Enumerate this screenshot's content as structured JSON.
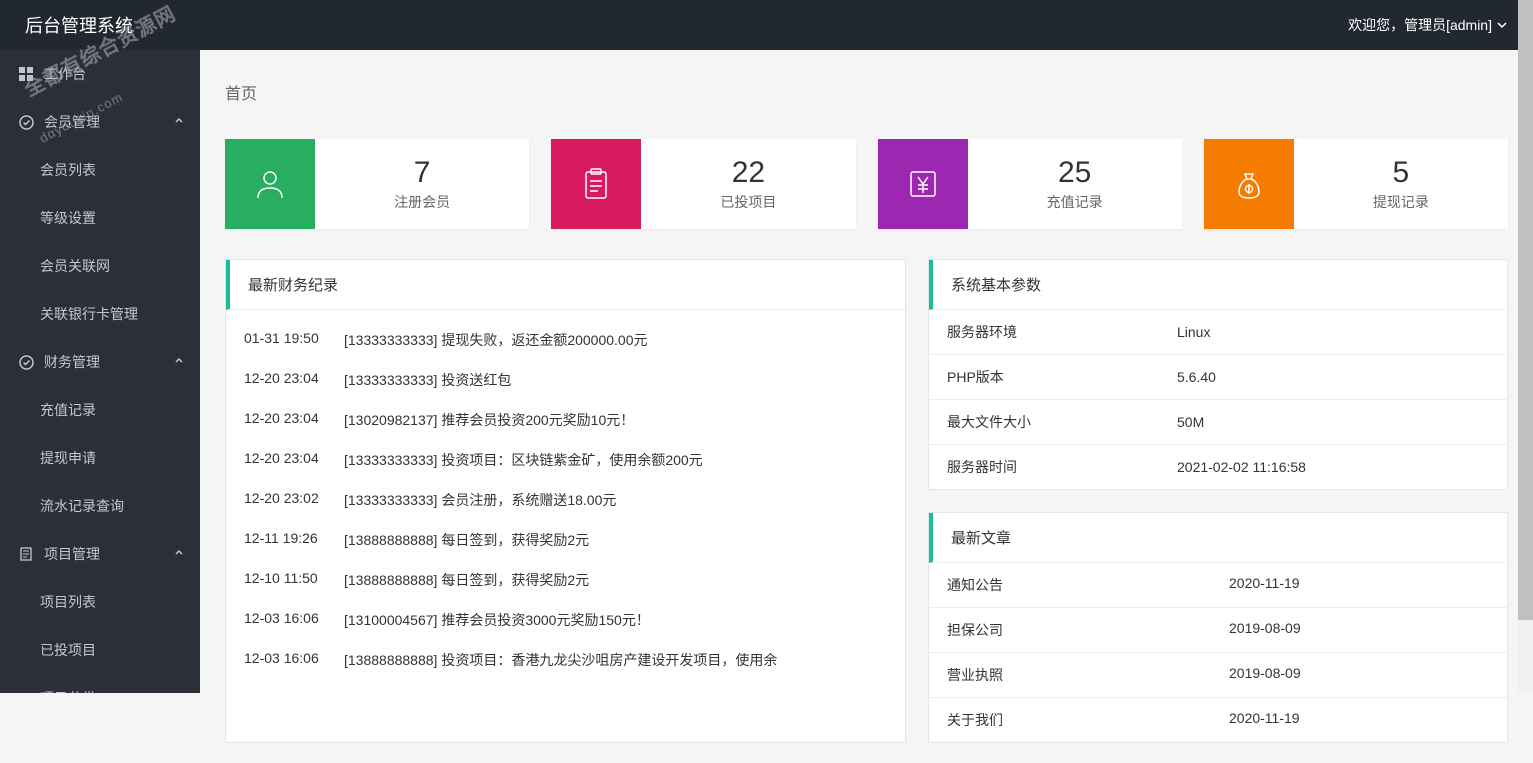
{
  "header": {
    "title": "后台管理系统",
    "welcome": "欢迎您，管理员[admin]"
  },
  "sidebar": {
    "items": [
      {
        "label": "工作台",
        "icon": "grid",
        "hasChevron": false
      },
      {
        "label": "会员管理",
        "icon": "circle-check",
        "hasChevron": true,
        "expanded": true
      },
      {
        "label": "会员列表",
        "secondary": true
      },
      {
        "label": "等级设置",
        "secondary": true
      },
      {
        "label": "会员关联网",
        "secondary": true
      },
      {
        "label": "关联银行卡管理",
        "secondary": true
      },
      {
        "label": "财务管理",
        "icon": "circle-check",
        "hasChevron": true,
        "expanded": true
      },
      {
        "label": "充值记录",
        "secondary": true
      },
      {
        "label": "提现申请",
        "secondary": true
      },
      {
        "label": "流水记录查询",
        "secondary": true
      },
      {
        "label": "项目管理",
        "icon": "doc",
        "hasChevron": true,
        "expanded": true
      },
      {
        "label": "项目列表",
        "secondary": true
      },
      {
        "label": "已投项目",
        "secondary": true
      },
      {
        "label": "项目分类",
        "secondary": true
      }
    ]
  },
  "breadcrumb": "首页",
  "stats": [
    {
      "value": "7",
      "label": "注册会员",
      "color": "green",
      "icon": "user"
    },
    {
      "value": "22",
      "label": "已投项目",
      "color": "pink",
      "icon": "clipboard"
    },
    {
      "value": "25",
      "label": "充值记录",
      "color": "purple",
      "icon": "yen"
    },
    {
      "value": "5",
      "label": "提现记录",
      "color": "orange",
      "icon": "moneybag"
    }
  ],
  "finance": {
    "title": "最新财务纪录",
    "logs": [
      {
        "time": "01-31 19:50",
        "text": "[13333333333] 提现失败，返还金额200000.00元"
      },
      {
        "time": "12-20 23:04",
        "text": "[13333333333] 投资送红包"
      },
      {
        "time": "12-20 23:04",
        "text": "[13020982137] 推荐会员投资200元奖励10元！"
      },
      {
        "time": "12-20 23:04",
        "text": "[13333333333] 投资项目：区块链紫金矿，使用余额200元"
      },
      {
        "time": "12-20 23:02",
        "text": "[13333333333] 会员注册，系统赠送18.00元"
      },
      {
        "time": "12-11 19:26",
        "text": "[13888888888] 每日签到，获得奖励2元"
      },
      {
        "time": "12-10 11:50",
        "text": "[13888888888] 每日签到，获得奖励2元"
      },
      {
        "time": "12-03 16:06",
        "text": "[13100004567] 推荐会员投资3000元奖励150元！"
      },
      {
        "time": "12-03 16:06",
        "text": "[13888888888] 投资项目：香港九龙尖沙咀房产建设开发项目，使用余"
      }
    ]
  },
  "system": {
    "title": "系统基本参数",
    "rows": [
      {
        "key": "服务器环境",
        "value": "Linux"
      },
      {
        "key": "PHP版本",
        "value": "5.6.40"
      },
      {
        "key": "最大文件大小",
        "value": "50M"
      },
      {
        "key": "服务器时间",
        "value": "2021-02-02 11:16:58"
      }
    ]
  },
  "articles": {
    "title": "最新文章",
    "items": [
      {
        "title": "通知公告",
        "date": "2020-11-19"
      },
      {
        "title": "担保公司",
        "date": "2019-08-09"
      },
      {
        "title": "营业执照",
        "date": "2019-08-09"
      },
      {
        "title": "关于我们",
        "date": "2020-11-19"
      }
    ]
  },
  "watermark": {
    "line1": "全都有综合资源网",
    "line2": "dαyouvip.com"
  }
}
